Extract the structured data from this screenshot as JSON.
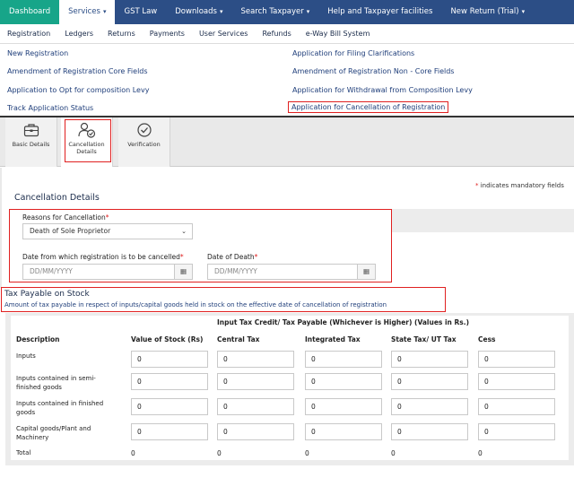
{
  "topnav": {
    "items": [
      {
        "label": "Dashboard",
        "caret": ""
      },
      {
        "label": "Services",
        "caret": "▾"
      },
      {
        "label": "GST Law",
        "caret": ""
      },
      {
        "label": "Downloads",
        "caret": "▾"
      },
      {
        "label": "Search Taxpayer",
        "caret": "▾"
      },
      {
        "label": "Help and Taxpayer facilities",
        "caret": ""
      },
      {
        "label": "New Return (Trial)",
        "caret": "▾"
      }
    ]
  },
  "subnav": {
    "items": [
      "Registration",
      "Ledgers",
      "Returns",
      "Payments",
      "User Services",
      "Refunds",
      "e-Way Bill System"
    ]
  },
  "dropdown": {
    "left": [
      "New Registration",
      "Amendment of Registration Core Fields",
      "Application to Opt for composition Levy",
      "Track Application Status"
    ],
    "right": [
      "Application for Filing Clarifications",
      "Amendment of Registration Non - Core Fields",
      "Application for Withdrawal from Composition Levy",
      "Application for Cancellation of Registration"
    ]
  },
  "tabs": {
    "basic": {
      "label": "Basic Details"
    },
    "cancellation": {
      "label1": "Cancellation",
      "label2": "Details"
    },
    "verification": {
      "label": "Verification"
    }
  },
  "form": {
    "mandatory_star": "*",
    "mandatory_text": " indicates mandatory fields",
    "section_title": "Cancellation Details",
    "reasons_label": "Reasons for Cancellation",
    "reasons_value": "Death of Sole Proprietor",
    "date_from_label": "Date from which registration is to be cancelled",
    "date_from_placeholder": "DD/MM/YYYY",
    "death_label": "Date of Death",
    "death_placeholder": "DD/MM/YYYY",
    "req": "*"
  },
  "tax": {
    "title": "Tax Payable on Stock",
    "desc": "Amount of tax payable in respect of inputs/capital goods held in stock on the effective date of cancellation of registration",
    "group_header": "Input Tax Credit/ Tax Payable (Whichever is Higher) (Values in Rs.)",
    "columns": [
      "Description",
      "Value of Stock (Rs)",
      "Central Tax",
      "Integrated Tax",
      "State Tax/ UT Tax",
      "Cess"
    ],
    "rows": [
      {
        "label": "Inputs",
        "values": [
          "0",
          "0",
          "0",
          "0",
          "0"
        ]
      },
      {
        "label": "Inputs contained in semi-finished goods",
        "values": [
          "0",
          "0",
          "0",
          "0",
          "0"
        ]
      },
      {
        "label": "Inputs contained in finished goods",
        "values": [
          "0",
          "0",
          "0",
          "0",
          "0"
        ]
      },
      {
        "label": "Capital goods/Plant and Machinery",
        "values": [
          "0",
          "0",
          "0",
          "0",
          "0"
        ]
      }
    ],
    "total_label": "Total",
    "totals": [
      "0",
      "0",
      "0",
      "0",
      "0"
    ]
  }
}
